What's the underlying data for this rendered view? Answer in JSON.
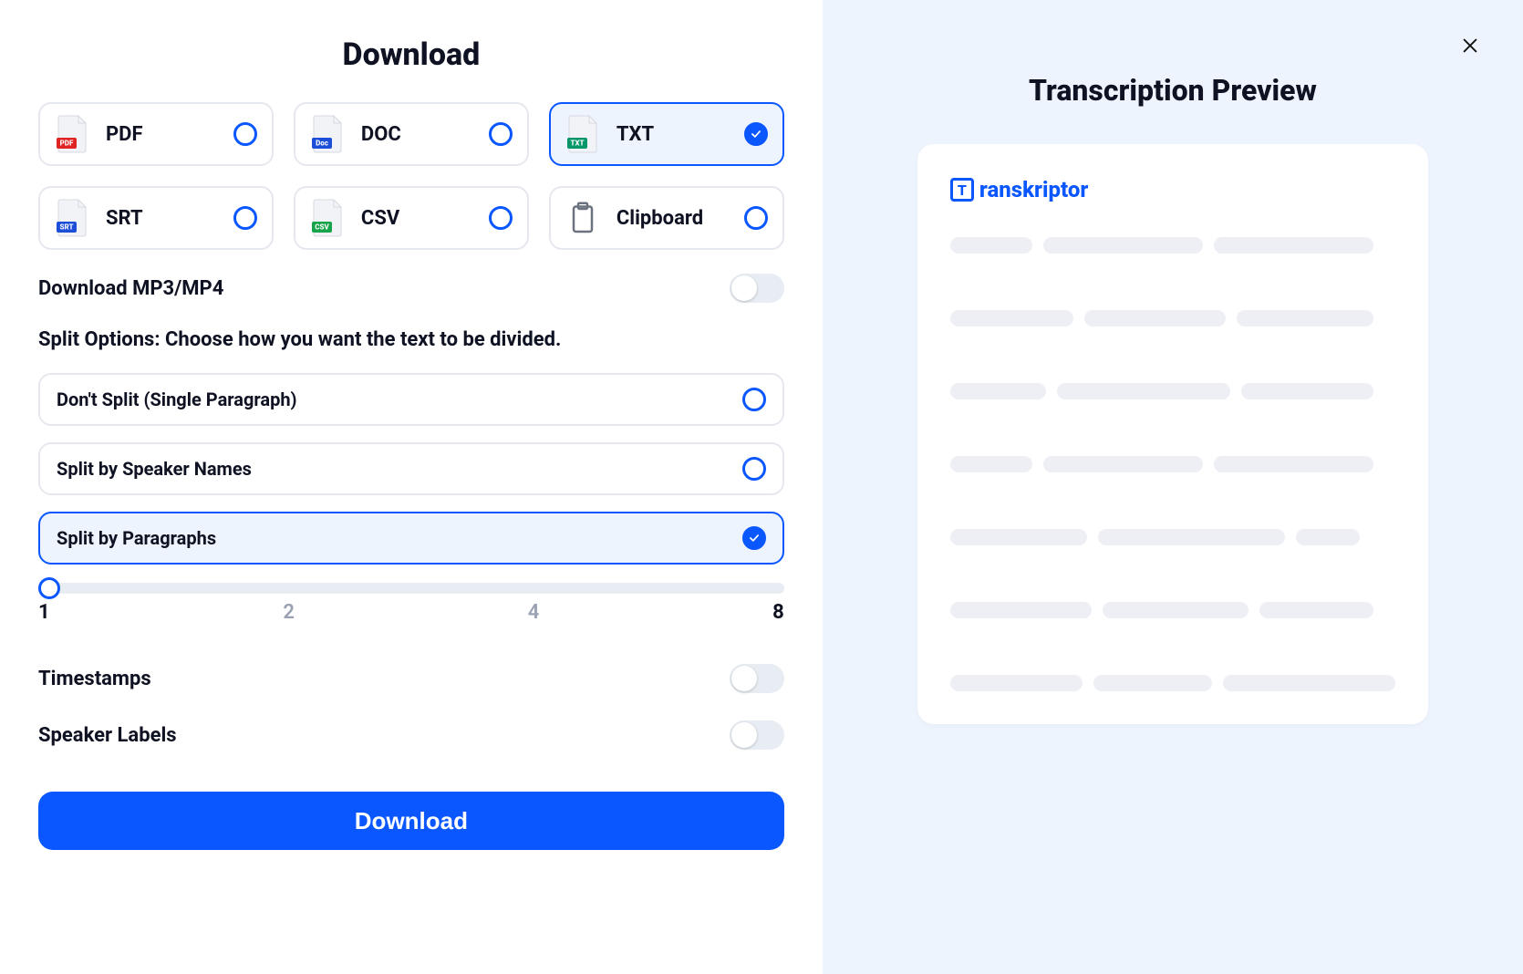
{
  "left": {
    "title": "Download",
    "formats": [
      {
        "key": "pdf",
        "label": "PDF",
        "badge": "PDF",
        "badgeColor": "#e02424",
        "selected": false
      },
      {
        "key": "doc",
        "label": "DOC",
        "badge": "Doc",
        "badgeColor": "#1d4ed8",
        "selected": false
      },
      {
        "key": "txt",
        "label": "TXT",
        "badge": "TXT",
        "badgeColor": "#059669",
        "selected": true
      },
      {
        "key": "srt",
        "label": "SRT",
        "badge": "SRT",
        "badgeColor": "#1d4ed8",
        "selected": false
      },
      {
        "key": "csv",
        "label": "CSV",
        "badge": "CSV",
        "badgeColor": "#16a34a",
        "selected": false
      },
      {
        "key": "clipboard",
        "label": "Clipboard",
        "badge": null,
        "badgeColor": null,
        "selected": false,
        "isClipboard": true
      }
    ],
    "mp3mp4": {
      "label": "Download MP3/MP4",
      "enabled": false
    },
    "splitSectionLabel": "Split Options: Choose how you want the text to be divided.",
    "splitOptions": [
      {
        "key": "none",
        "label": "Don't Split (Single Paragraph)",
        "selected": false
      },
      {
        "key": "speaker",
        "label": "Split by Speaker Names",
        "selected": false
      },
      {
        "key": "paragraph",
        "label": "Split by Paragraphs",
        "selected": true
      }
    ],
    "slider": {
      "value": 1,
      "min": 1,
      "max": 8,
      "ticks": [
        "1",
        "2",
        "4",
        "8"
      ]
    },
    "toggles": [
      {
        "key": "timestamps",
        "label": "Timestamps",
        "enabled": false
      },
      {
        "key": "speakerLabels",
        "label": "Speaker Labels",
        "enabled": false
      }
    ],
    "downloadButton": "Download"
  },
  "right": {
    "title": "Transcription Preview",
    "brand": {
      "letter": "T",
      "rest": "ranskriptor"
    },
    "skeletonRows": [
      [
        90,
        175,
        175
      ],
      [
        135,
        155,
        150
      ],
      [
        105,
        190,
        145
      ],
      [
        90,
        175,
        175
      ],
      [
        150,
        205,
        70
      ],
      [
        155,
        160,
        125
      ],
      [
        150,
        135,
        195
      ]
    ]
  }
}
